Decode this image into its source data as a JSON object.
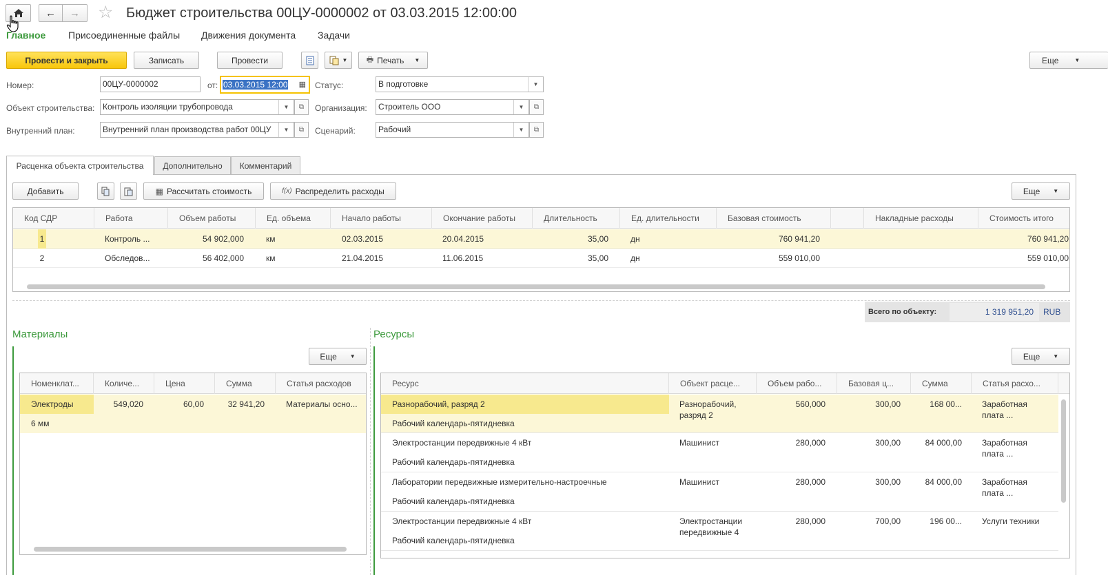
{
  "window": {
    "title": "Бюджет строительства 00ЦУ-0000002 от 03.03.2015 12:00:00"
  },
  "nav": {
    "tabs": [
      "Главное",
      "Присоединенные файлы",
      "Движения документа",
      "Задачи"
    ]
  },
  "toolbar": {
    "post_close": "Провести и закрыть",
    "save": "Записать",
    "post": "Провести",
    "print": "Печать",
    "more": "Еще"
  },
  "form": {
    "number_label": "Номер:",
    "number": "00ЦУ-0000002",
    "date_label": "от:",
    "date": "03.03.2015 12:00",
    "status_label": "Статус:",
    "status": "В подготовке",
    "object_label": "Объект строительства:",
    "object": "Контроль изоляции трубопровода",
    "org_label": "Организация:",
    "org": "Строитель ООО",
    "plan_label": "Внутренний план:",
    "plan": "Внутренний план производства работ 00ЦУ",
    "scenario_label": "Сценарий:",
    "scenario": "Рабочий"
  },
  "tabs": [
    "Расценка объекта строительства",
    "Дополнительно",
    "Комментарий"
  ],
  "pricing": {
    "add": "Добавить",
    "calc": "Рассчитать стоимость",
    "distribute": "Распределить расходы",
    "more": "Еще",
    "headers": [
      "Код СДР",
      "Работа",
      "Объем работы",
      "Ед. объема",
      "Начало работы",
      "Окончание работы",
      "Длительность",
      "Ед. длительности",
      "Базовая стоимость",
      "",
      "Накладные расходы",
      "Стоимость итого"
    ],
    "rows": [
      {
        "code": "1",
        "work": "Контроль ...",
        "volume": "54 902,000",
        "unit": "км",
        "start": "02.03.2015",
        "end": "20.04.2015",
        "duration": "35,00",
        "dur_unit": "дн",
        "base": "760 941,20",
        "overhead": "",
        "total": "760 941,20"
      },
      {
        "code": "2",
        "work": "Обследов...",
        "volume": "56 402,000",
        "unit": "км",
        "start": "21.04.2015",
        "end": "11.06.2015",
        "duration": "35,00",
        "dur_unit": "дн",
        "base": "559 010,00",
        "overhead": "",
        "total": "559 010,00"
      }
    ],
    "total_label": "Всего по объекту:",
    "total_value": "1 319 951,20",
    "currency": "RUB"
  },
  "materials": {
    "title": "Материалы",
    "more": "Еще",
    "headers": [
      "Номенклат...",
      "Количе...",
      "Цена",
      "Сумма",
      "Статья расходов"
    ],
    "rows": [
      {
        "name": "Электроды",
        "sub": "6 мм",
        "qty": "549,020",
        "price": "60,00",
        "sum": "32 941,20",
        "article": "Материалы осно..."
      }
    ]
  },
  "resources": {
    "title": "Ресурсы",
    "more": "Еще",
    "headers": [
      "Ресурс",
      "Объект расце...",
      "Объем рабо...",
      "Базовая ц...",
      "Сумма",
      "Статья расхо..."
    ],
    "rows": [
      {
        "res": "Разнорабочий, разряд 2",
        "cal": "Рабочий календарь-пятидневка",
        "obj1": "Разнорабочий,",
        "obj2": "разряд 2",
        "vol": "560,000",
        "price": "300,00",
        "sum": "168 00...",
        "art1": "Заработная",
        "art2": "плата ..."
      },
      {
        "res": "Электростанции передвижные 4 кВт",
        "cal": "Рабочий календарь-пятидневка",
        "obj1": "Машинист",
        "obj2": "",
        "vol": "280,000",
        "price": "300,00",
        "sum": "84 000,00",
        "art1": "Заработная",
        "art2": "плата ..."
      },
      {
        "res": "Лаборатории передвижные измерительно-настроечные",
        "cal": "Рабочий календарь-пятидневка",
        "obj1": "Машинист",
        "obj2": "",
        "vol": "280,000",
        "price": "300,00",
        "sum": "84 000,00",
        "art1": "Заработная",
        "art2": "плата ..."
      },
      {
        "res": "Электростанции передвижные 4 кВт",
        "cal": "Рабочий календарь-пятидневка",
        "obj1": "Электростанции",
        "obj2": "передвижные 4",
        "vol": "280,000",
        "price": "700,00",
        "sum": "196 00...",
        "art1": "Услуги техники",
        "art2": ""
      }
    ]
  }
}
